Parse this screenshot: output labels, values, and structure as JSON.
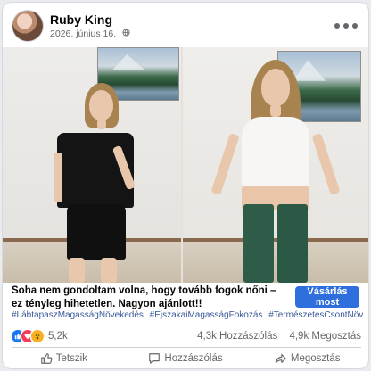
{
  "post": {
    "author": "Ruby King",
    "date": "2026. június 16.",
    "visibility_icon": "globe-icon",
    "more_icon": "more-options-icon"
  },
  "caption": "Soha nem gondoltam volna, hogy tovább fogok nőni – ez tényleg hihetetlen. Nagyon ajánlott!!",
  "cta": {
    "label": "Vásárlás most",
    "color": "#2f6fdd"
  },
  "hashtags": [
    "#LábtapaszMagasságNövekedés",
    "#ÉjszakaiMagasságFokozás",
    "#TermészetesCsontNövekedés"
  ],
  "stats": {
    "reactions": [
      "like-icon",
      "love-icon",
      "wow-icon"
    ],
    "reaction_count": "5,2k",
    "comments": "4,3k Hozzászólás",
    "shares": "4,9k Megosztás"
  },
  "actions": {
    "like": "Tetszik",
    "comment": "Hozzászólás",
    "share": "Megosztás"
  },
  "colors": {
    "link": "#385898",
    "secondary_text": "#65676b",
    "like_blue": "#1877f2"
  }
}
